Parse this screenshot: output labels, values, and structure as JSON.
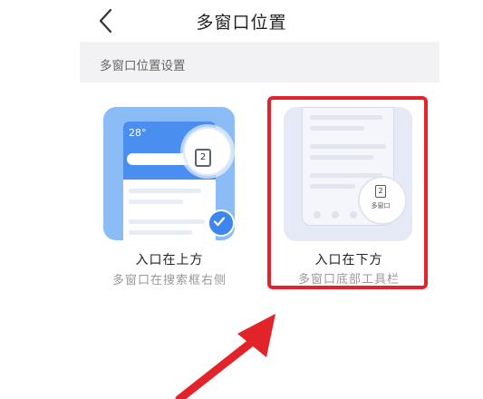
{
  "header": {
    "back_icon": "chevron-left-icon",
    "title": "多窗口位置"
  },
  "section": {
    "label": "多窗口位置设置"
  },
  "options": [
    {
      "title": "入口在上方",
      "subtitle": "多窗口在搜索框右侧",
      "selected": true,
      "preview_temp": "28°",
      "preview_badge": "2"
    },
    {
      "title": "入口在下方",
      "subtitle": "多窗口底部工具栏",
      "selected": false,
      "preview_badge": "2",
      "preview_label": "多窗口"
    }
  ],
  "colors": {
    "accent": "#3d85ef",
    "highlight": "#e3232a",
    "section_bg": "#f2f2f4"
  }
}
